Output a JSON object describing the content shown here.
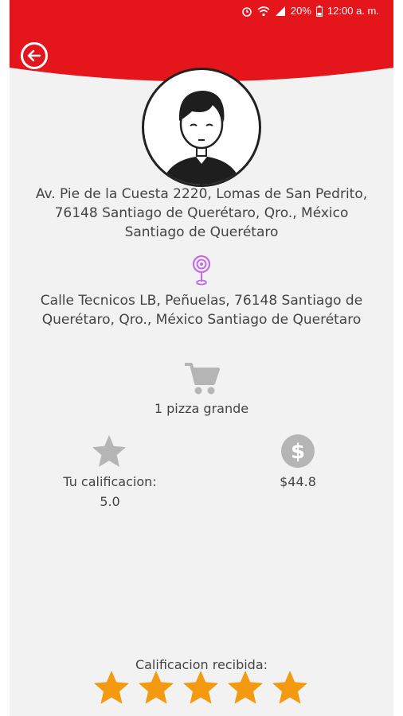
{
  "status_bar": {
    "battery": "20%",
    "time": "12:00 a. m."
  },
  "origin_address": "Av. Pie de la Cuesta 2220, Lomas de San Pedrito, 76148 Santiago de Querétaro, Qro., México Santiago de Querétaro",
  "destination_address": "Calle Tecnicos LB, Peñuelas, 76148 Santiago de Querétaro, Qro., México Santiago de Querétaro",
  "order_description": "1 pizza grande",
  "rating": {
    "label": "Tu calificacion:",
    "value": "5.0"
  },
  "price": "$44.8",
  "received_rating": {
    "label": "Calificacion recibida:",
    "stars": 5
  },
  "colors": {
    "header": "#e5161b",
    "star": "#f39a11",
    "icon_gray": "#b5b5b5",
    "pin": "#c46be8"
  },
  "icons": [
    "back-arrow-icon",
    "location-pin-icon",
    "cart-icon",
    "star-icon",
    "dollar-icon"
  ]
}
